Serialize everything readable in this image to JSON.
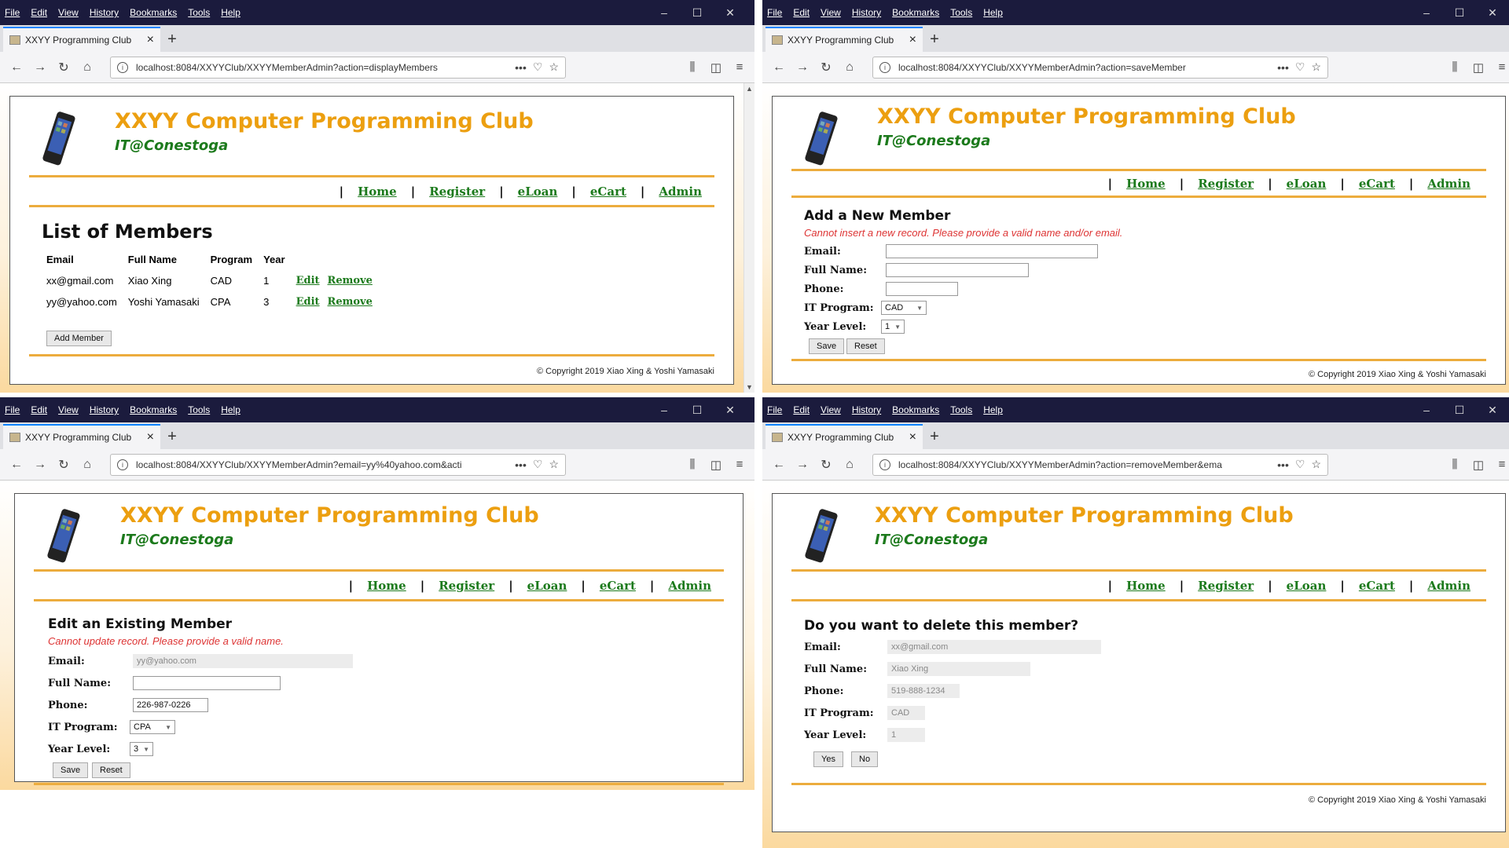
{
  "browser": {
    "menu": [
      "File",
      "Edit",
      "View",
      "History",
      "Bookmarks",
      "Tools",
      "Help"
    ],
    "tab_title": "XXYY Programming Club",
    "window_controls": [
      "–",
      "☐",
      "✕"
    ]
  },
  "site": {
    "title": "XXYY Computer Programming Club",
    "subtitle": "IT@Conestoga",
    "nav": [
      "Home",
      "Register",
      "eLoan",
      "eCart",
      "Admin"
    ],
    "nav_sep": "|",
    "copyright": "© Copyright 2019 Xiao Xing & Yoshi Yamasaki"
  },
  "win1": {
    "url": "localhost:8084/XXYYClub/XXYYMemberAdmin?action=displayMembers",
    "heading": "List of Members",
    "columns": [
      "Email",
      "Full Name",
      "Program",
      "Year"
    ],
    "rows": [
      {
        "email": "xx@gmail.com",
        "name": "Xiao Xing",
        "program": "CAD",
        "year": "1",
        "edit": "Edit",
        "remove": "Remove"
      },
      {
        "email": "yy@yahoo.com",
        "name": "Yoshi Yamasaki",
        "program": "CPA",
        "year": "3",
        "edit": "Edit",
        "remove": "Remove"
      }
    ],
    "add_button": "Add Member"
  },
  "win2": {
    "url": "localhost:8084/XXYYClub/XXYYMemberAdmin?action=saveMember",
    "heading": "Add a New Member",
    "error": "Cannot insert a new record. Please provide a valid name and/or email.",
    "labels": {
      "email": "Email:",
      "name": "Full Name:",
      "phone": "Phone:",
      "program": "IT Program:",
      "year": "Year Level:"
    },
    "values": {
      "email": "",
      "name": "",
      "phone": "",
      "program": "CAD",
      "year": "1"
    },
    "save": "Save",
    "reset": "Reset"
  },
  "win3": {
    "url": "localhost:8084/XXYYClub/XXYYMemberAdmin?email=yy%40yahoo.com&acti",
    "heading": "Edit an Existing Member",
    "error": "Cannot update record. Please provide a valid name.",
    "labels": {
      "email": "Email:",
      "name": "Full Name:",
      "phone": "Phone:",
      "program": "IT Program:",
      "year": "Year Level:"
    },
    "values": {
      "email": "yy@yahoo.com",
      "name": "",
      "phone": "226-987-0226",
      "program": "CPA",
      "year": "3"
    },
    "save": "Save",
    "reset": "Reset"
  },
  "win4": {
    "url": "localhost:8084/XXYYClub/XXYYMemberAdmin?action=removeMember&ema",
    "heading": "Do you want to delete this member?",
    "labels": {
      "email": "Email:",
      "name": "Full Name:",
      "phone": "Phone:",
      "program": "IT Program:",
      "year": "Year Level:"
    },
    "values": {
      "email": "xx@gmail.com",
      "name": "Xiao Xing",
      "phone": "519-888-1234",
      "program": "CAD",
      "year": "1"
    },
    "yes": "Yes",
    "no": "No"
  }
}
